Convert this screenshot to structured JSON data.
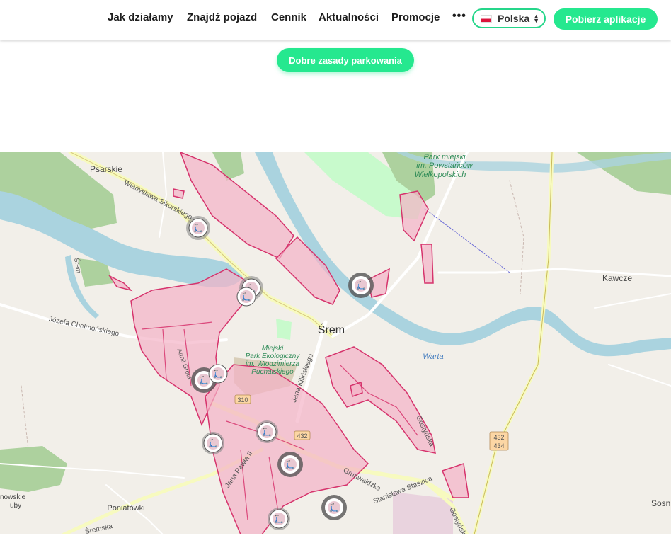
{
  "header": {
    "nav": [
      {
        "label": "Jak działamy"
      },
      {
        "label": "Znajdź pojazd"
      },
      {
        "label": "Cennik"
      },
      {
        "label": "Aktualności"
      },
      {
        "label": "Promocje"
      }
    ],
    "more_label": "•••",
    "language": {
      "label": "Polska"
    },
    "download_label": "Pobierz aplikacje"
  },
  "parking_button_label": "Dobre zasady parkowania",
  "map": {
    "labels": {
      "psarskie": "Psarskie",
      "park_1": "Park miejski",
      "park_2": "im. Powstańców",
      "park_3": "Wielkopolskich",
      "kawcze": "Kawcze",
      "srem": "Śrem",
      "warta": "Warta",
      "sikorskiego": "Władysława Sikorskiego",
      "chelmonskiego": "Józefa Chełmońskiego",
      "ekopark_1": "Miejski",
      "ekopark_2": "Park Ekologiczny",
      "ekopark_3": "im. Włodzimierza",
      "ekopark_4": "Puchalskiego",
      "kilinskiego": "Jana Kilińskiego",
      "grunwaldzka": "Grunwaldzka",
      "staszica": "Stanisława Staszica",
      "gostynska": "Gostyńska",
      "jana_pawla": "Jana Pawła II",
      "poniatowki": "Poniatówki",
      "sremska": "Śremska",
      "road_310": "310",
      "road_432": "432",
      "road_432b": "432",
      "road_434": "434",
      "nowskie": "nowskie",
      "uby": "uby",
      "sosn": "Sosn",
      "srem_left": "Śrem",
      "grota": "Armii Grota"
    }
  }
}
